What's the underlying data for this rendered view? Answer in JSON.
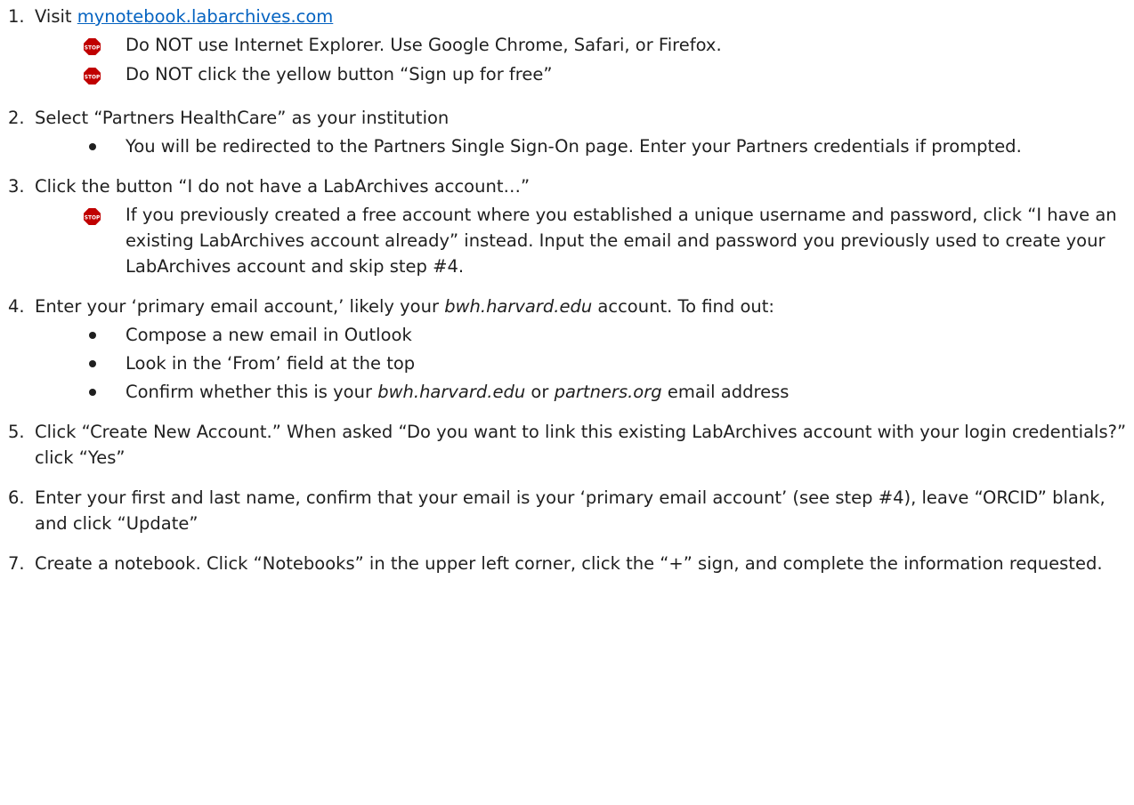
{
  "steps": [
    {
      "num": "1.",
      "text_before": "Visit ",
      "link": "mynotebook.labarchives.com",
      "subs": [
        {
          "marker": "stop-icon",
          "text": "Do NOT use Internet Explorer. Use Google Chrome, Safari, or Firefox."
        },
        {
          "marker": "stop-icon",
          "text": "Do NOT click the yellow button “Sign up for free”"
        }
      ]
    },
    {
      "num": "2.",
      "text": "Select “Partners HealthCare” as your institution",
      "subs": [
        {
          "marker": "bullet",
          "text": "You will be redirected to the Partners Single Sign-On page. Enter your Partners credentials if prompted."
        }
      ]
    },
    {
      "num": "3.",
      "text": "Click the button “I do not have a LabArchives account…”",
      "subs": [
        {
          "marker": "stop-icon",
          "text": "If you previously created a free account where you established a unique username and password, click “I have an existing LabArchives account already” instead. Input the email and password you previously used to create your LabArchives account and skip step #4."
        }
      ]
    },
    {
      "num": "4.",
      "text_a": "Enter your ‘primary email account,’ likely your ",
      "text_em": "bwh.harvard.edu",
      "text_b": " account. To find out:",
      "subs": [
        {
          "marker": "bullet",
          "text": "Compose a new email in Outlook"
        },
        {
          "marker": "bullet",
          "text": "Look in the ‘From’ field at the top"
        },
        {
          "marker": "bullet",
          "a": "Confirm whether this is your ",
          "em1": "bwh.harvard.edu",
          "b": " or ",
          "em2": "partners.org",
          "c": " email address"
        }
      ]
    },
    {
      "num": "5.",
      "text": "Click “Create New Account.” When asked “Do you want to link this existing LabArchives account with your login credentials?” click “Yes”"
    },
    {
      "num": "6.",
      "text": "Enter your first and last name, confirm that your email is your ‘primary email account’ (see step #4), leave “ORCID” blank, and click “Update”"
    },
    {
      "num": "7.",
      "text": "Create a notebook. Click “Notebooks” in the upper left corner, click the “+” sign, and complete the information requested."
    }
  ],
  "colors": {
    "link": "#0563c1",
    "stop_icon": "#c00000",
    "text": "#1f1f1f"
  }
}
